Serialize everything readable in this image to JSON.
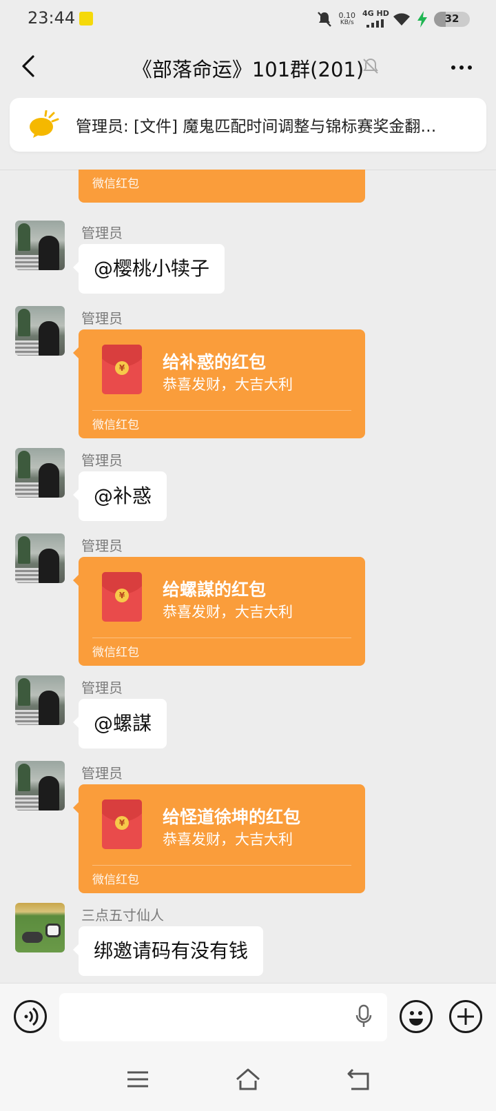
{
  "status_bar": {
    "time": "23:44",
    "net_speed_value": "0.10",
    "net_speed_unit": "KB/s",
    "network": "4G HD",
    "battery": "32",
    "battery_level": 0.32,
    "icons": [
      "app-notification-icon",
      "mute-notification-icon",
      "signal-icon",
      "wifi-icon",
      "charging-icon",
      "battery-icon"
    ]
  },
  "header": {
    "title": "《部落命运》101群(201)",
    "icons": [
      "back-arrow-icon",
      "mute-bell-icon",
      "more-icon"
    ]
  },
  "pinned": {
    "text": "管理员: [文件] 魔鬼匹配时间调整与锦标赛奖金翻…",
    "icon": "announcement-icon"
  },
  "messages": [
    {
      "type": "red_packet_partial",
      "label": "微信红包"
    },
    {
      "type": "text",
      "sender": "管理员",
      "text": "@樱桃小犊子"
    },
    {
      "type": "red_packet",
      "sender": "管理员",
      "title": "给补惑的红包",
      "subtitle": "恭喜发财，大吉大利",
      "label": "微信红包"
    },
    {
      "type": "text",
      "sender": "管理员",
      "text": "@补惑"
    },
    {
      "type": "red_packet",
      "sender": "管理员",
      "title": "给螺謀的红包",
      "subtitle": "恭喜发财，大吉大利",
      "label": "微信红包"
    },
    {
      "type": "text",
      "sender": "管理员",
      "text": "@螺謀"
    },
    {
      "type": "red_packet",
      "sender": "管理员",
      "title": "给怪道徐坤的红包",
      "subtitle": "恭喜发财，大吉大利",
      "label": "微信红包"
    },
    {
      "type": "text",
      "sender": "三点五寸仙人",
      "text": "绑邀请码有没有钱"
    }
  ],
  "red_packet_coin": "¥",
  "input_bar": {
    "placeholder": "",
    "icons": [
      "voice-icon",
      "microphone-icon",
      "emoji-icon",
      "plus-icon"
    ]
  },
  "nav_bar": {
    "icons": [
      "menu-icon",
      "home-icon",
      "back-icon"
    ]
  },
  "colors": {
    "background": "#ededed",
    "red_packet": "#fa9d3b",
    "envelope": "#e94b4b"
  }
}
